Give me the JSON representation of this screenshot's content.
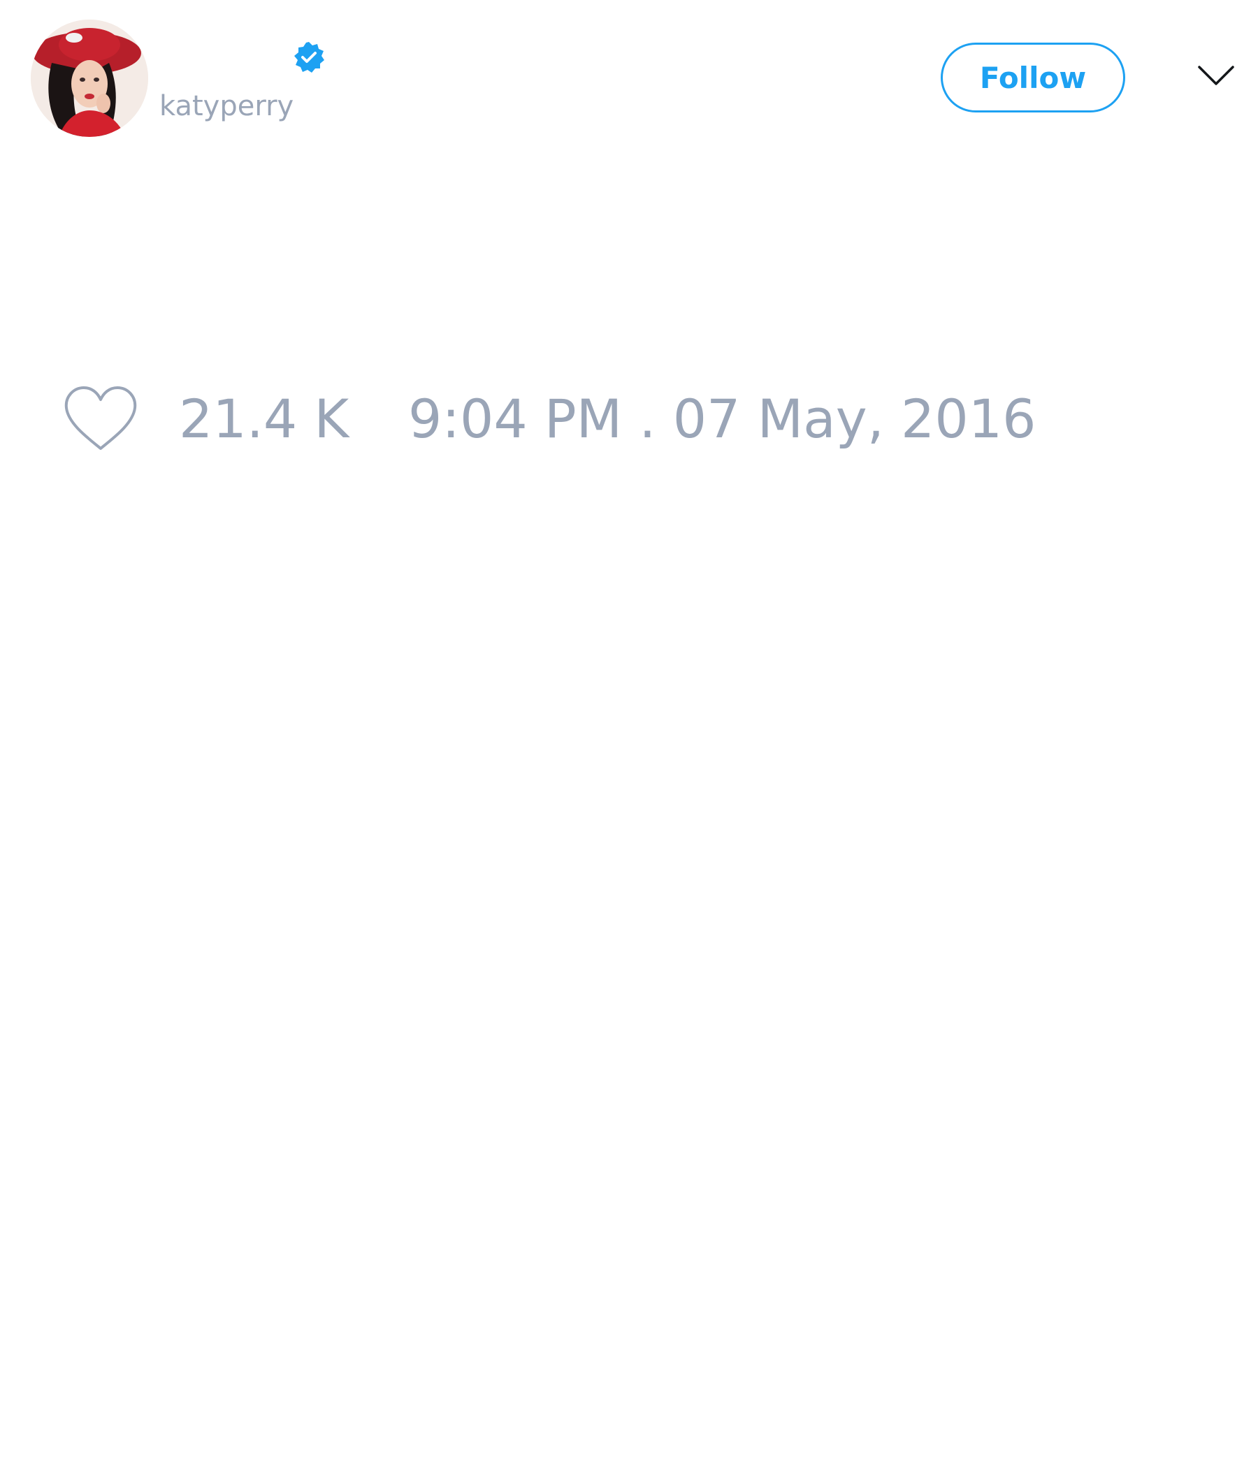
{
  "header": {
    "username": "katyperry",
    "follow_label": "Follow",
    "avatar_icon": "profile-photo",
    "verified_icon": "verified-badge-icon",
    "menu_icon": "chevron-down-icon"
  },
  "actions": {
    "like_icon": "heart-outline-icon",
    "like_count": "21.4 K",
    "timestamp": "9:04 PM . 07 May, 2016"
  },
  "colors": {
    "accent": "#1da1f2",
    "muted_text": "#9aa5b7",
    "background": "#ffffff"
  }
}
